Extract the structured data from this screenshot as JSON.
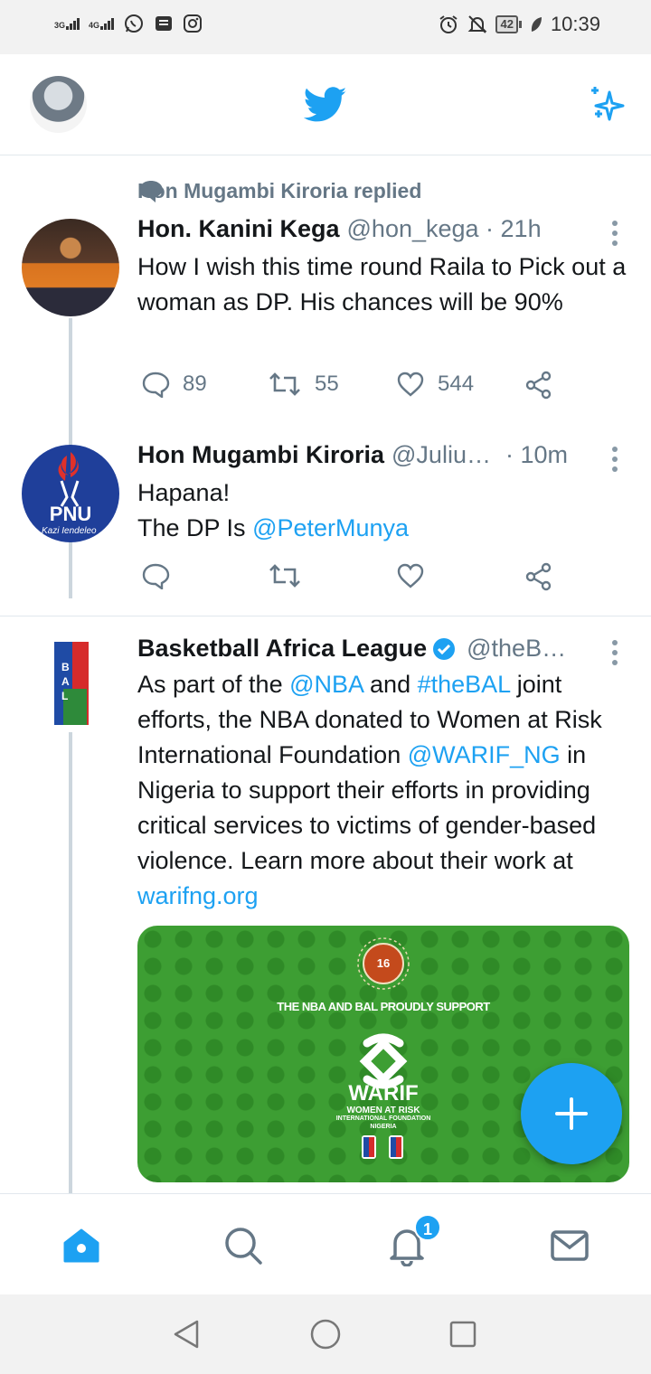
{
  "status_bar": {
    "sim1": "3G",
    "sim2": "4G",
    "battery": "42",
    "time": "10:39",
    "icons": [
      "whatsapp-icon",
      "message-icon",
      "instagram-icon",
      "alarm-icon",
      "mute-icon",
      "leaf-icon"
    ]
  },
  "header": {
    "logo": "twitter-bird-icon",
    "sparkle": "sparkle-icon"
  },
  "tweets": [
    {
      "context": "Hon Mugambi Kiroria replied",
      "name": "Hon. Kanini Kega",
      "handle": "@hon_kega · 21h",
      "text": "How I wish this time round Raila to Pick out a woman as  DP. His chances will be 90%",
      "reply_count": "89",
      "retweet_count": "55",
      "like_count": "544"
    },
    {
      "name": "Hon Mugambi Kiroria",
      "handle": "@Juliu…",
      "time": "· 10m",
      "text_line1": "Hapana!",
      "text_line2_prefix": "The DP Is ",
      "text_line2_link": "@PeterMunya",
      "avatar_label": "PNU",
      "avatar_tagline": "Kazi Iendeleo"
    },
    {
      "name": "Basketball Africa League",
      "handle": "@theB…",
      "text_p1": "As part of the ",
      "text_l1": "@NBA",
      "text_p2": " and ",
      "text_l2": "#theBAL",
      "text_p3": " joint efforts, the NBA donated to Women at Risk International Foundation ",
      "text_l3": "@WARIF_NG",
      "text_p4": "  in Nigeria to support their efforts in providing critical services to victims of gender-based violence. Learn more about their work at ",
      "text_l4": "warifng.org",
      "avatar_label": "BAL",
      "media": {
        "caption": "THE NBA AND BAL PROUDLY SUPPORT",
        "logo_badge": "16",
        "org": "WARIF",
        "org_sub": "WOMEN AT RISK",
        "org_sub2": "INTERNATIONAL FOUNDATION",
        "org_sub3": "NIGERIA"
      }
    }
  ],
  "fab": {
    "icon": "compose-plus-icon"
  },
  "bottom_nav": {
    "items": [
      "home-icon",
      "search-icon",
      "notifications-icon",
      "messages-icon"
    ],
    "notification_count": "1"
  }
}
